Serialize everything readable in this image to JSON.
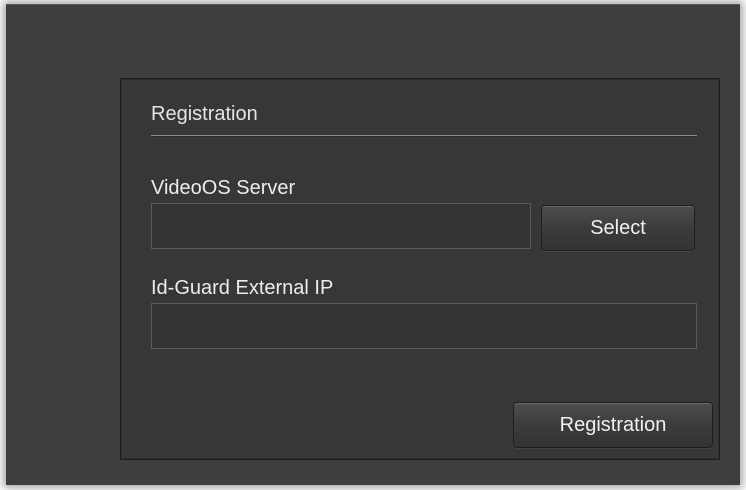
{
  "registration_panel": {
    "heading": "Registration",
    "videoos_server": {
      "label": "VideoOS Server",
      "value": "",
      "select_button_label": "Select"
    },
    "external_ip": {
      "label": "Id-Guard External IP",
      "value": ""
    },
    "register_button_label": "Registration"
  }
}
